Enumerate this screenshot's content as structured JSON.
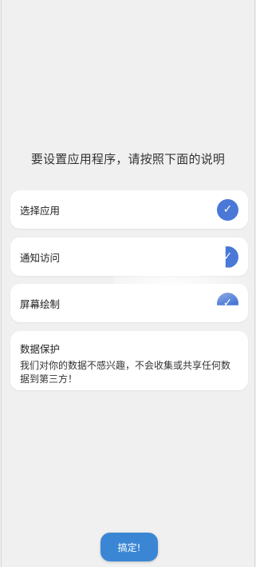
{
  "instruction": "要设置应用程序，请按照下面的说明",
  "steps": [
    {
      "label": "选择应用",
      "check": "✓"
    },
    {
      "label": "通知访问",
      "check": "✓"
    },
    {
      "label": "屏幕绘制",
      "check": "✓"
    }
  ],
  "privacy": {
    "title": "数据保护",
    "text": "我们对你的数据不感兴趣，不会收集或共享任何数据到第三方！"
  },
  "done_button": "搞定!",
  "colors": {
    "check_blue": "#4a78d6",
    "button_blue": "#3a86d4",
    "background": "#f0f0f0"
  }
}
